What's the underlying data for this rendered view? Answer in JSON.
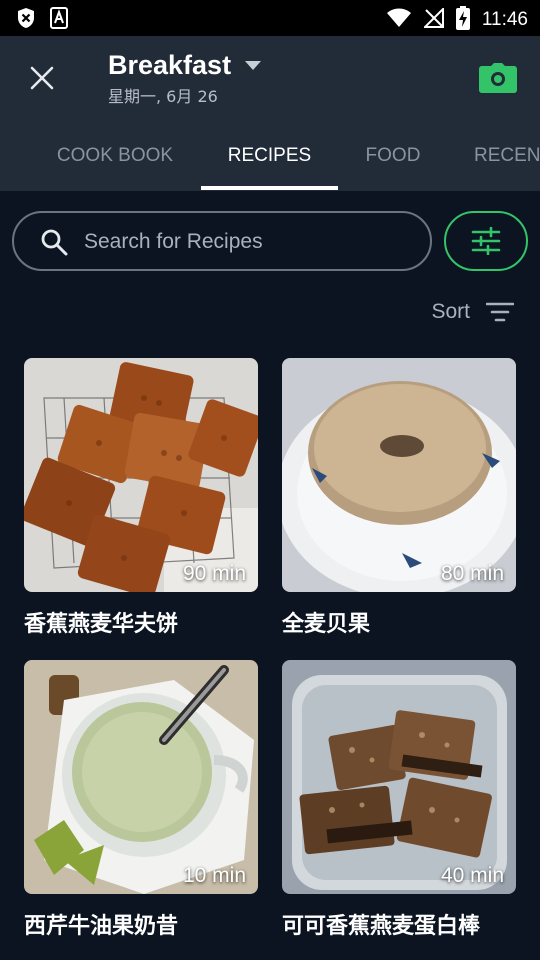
{
  "status_bar": {
    "time": "11:46"
  },
  "header": {
    "title": "Breakfast",
    "subtitle": "星期一, 6月 26"
  },
  "tabs": [
    {
      "label": "COOK BOOK",
      "active": false
    },
    {
      "label": "RECIPES",
      "active": true
    },
    {
      "label": "FOOD",
      "active": false
    },
    {
      "label": "RECEN",
      "active": false
    }
  ],
  "search": {
    "placeholder": "Search for Recipes",
    "value": ""
  },
  "sort": {
    "label": "Sort"
  },
  "colors": {
    "accent": "#33c46a",
    "background": "#0b1420",
    "header": "#222b38"
  },
  "recipes": [
    {
      "name": "香蕉燕麦华夫饼",
      "duration": "90 min",
      "image": "waffles"
    },
    {
      "name": "全麦贝果",
      "duration": "80 min",
      "image": "bagel"
    },
    {
      "name": "西芹牛油果奶昔",
      "duration": "10 min",
      "image": "smoothie"
    },
    {
      "name": "可可香蕉燕麦蛋白棒",
      "duration": "40 min",
      "image": "protein-bars"
    }
  ]
}
